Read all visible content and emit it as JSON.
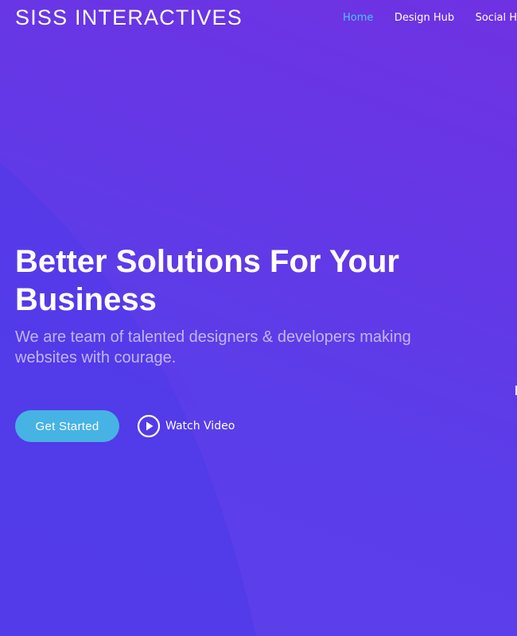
{
  "header": {
    "brand": "SISS INTERACTIVES",
    "nav": [
      {
        "label": "Home",
        "active": true
      },
      {
        "label": "Design Hub",
        "active": false
      },
      {
        "label": "Social Hub",
        "active": false
      }
    ]
  },
  "hero": {
    "title": "Better Solutions For Your Business",
    "subtitle": "We are team of talented designers & developers making websites with courage.",
    "cta_label": "Get Started",
    "video_label": "Watch Video"
  },
  "icons": {
    "play": "play-circle-icon"
  },
  "colors": {
    "background_start": "#6f32e2",
    "background_end": "#5a3ee9",
    "accent": "#47b2e4",
    "nav_active": "#4fc3f7",
    "text": "#ffffff"
  }
}
